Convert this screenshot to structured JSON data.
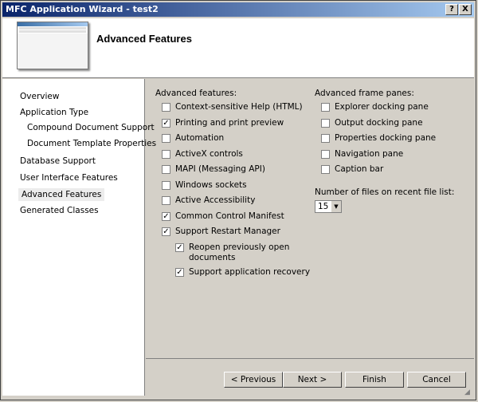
{
  "window": {
    "title": "MFC Application Wizard - test2",
    "help_label": "?",
    "close_label": "X"
  },
  "header": {
    "title": "Advanced Features"
  },
  "nav": {
    "items": [
      {
        "label": "Overview"
      },
      {
        "label": "Application Type"
      },
      {
        "label": "Compound Document Support"
      },
      {
        "label": "Document Template Properties"
      },
      {
        "label": "Database Support"
      },
      {
        "label": "User Interface Features"
      },
      {
        "label": "Advanced Features"
      },
      {
        "label": "Generated Classes"
      }
    ]
  },
  "advanced_features": {
    "label": "Advanced features:",
    "options": [
      {
        "label": "Context-sensitive Help (HTML)",
        "checked": false
      },
      {
        "label": "Printing and print preview",
        "checked": true
      },
      {
        "label": "Automation",
        "checked": false
      },
      {
        "label": "ActiveX controls",
        "checked": false
      },
      {
        "label": "MAPI (Messaging API)",
        "checked": false
      },
      {
        "label": "Windows sockets",
        "checked": false
      },
      {
        "label": "Active Accessibility",
        "checked": false
      },
      {
        "label": "Common Control Manifest",
        "checked": true
      },
      {
        "label": "Support Restart Manager",
        "checked": true
      }
    ],
    "sub_options": [
      {
        "label": "Reopen previously open",
        "label2": "documents",
        "checked": true
      },
      {
        "label": "Support application recovery",
        "checked": true
      }
    ]
  },
  "frame_panes": {
    "label": "Advanced frame panes:",
    "options": [
      {
        "label": "Explorer docking pane",
        "checked": false
      },
      {
        "label": "Output docking pane",
        "checked": false
      },
      {
        "label": "Properties docking pane",
        "checked": false
      },
      {
        "label": "Navigation pane",
        "checked": false
      },
      {
        "label": "Caption bar",
        "checked": false
      }
    ]
  },
  "recent_files": {
    "label": "Number of files on recent file list:",
    "value": "15"
  },
  "buttons": {
    "previous": "< Previous",
    "next": "Next >",
    "finish": "Finish",
    "cancel": "Cancel"
  },
  "check_mark": "✓"
}
